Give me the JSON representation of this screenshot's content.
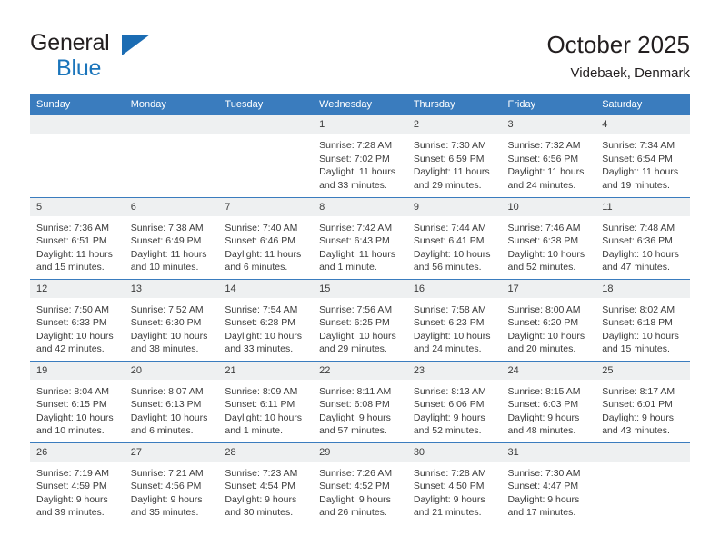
{
  "brand": {
    "name_top": "General",
    "name_bottom": "Blue",
    "accent_color": "#1b75bb",
    "triangle_icon": "brand-triangle-icon"
  },
  "header": {
    "month_title": "October 2025",
    "location": "Videbaek, Denmark"
  },
  "colors": {
    "header_row": "#3a7cbe",
    "daynum_band": "#eef0f1",
    "text": "#3b3b3b"
  },
  "weekday_headers": [
    "Sunday",
    "Monday",
    "Tuesday",
    "Wednesday",
    "Thursday",
    "Friday",
    "Saturday"
  ],
  "weeks": [
    [
      {
        "day": "",
        "empty": true
      },
      {
        "day": "",
        "empty": true
      },
      {
        "day": "",
        "empty": true
      },
      {
        "day": "1",
        "sunrise": "Sunrise: 7:28 AM",
        "sunset": "Sunset: 7:02 PM",
        "daylight_1": "Daylight: 11 hours",
        "daylight_2": "and 33 minutes."
      },
      {
        "day": "2",
        "sunrise": "Sunrise: 7:30 AM",
        "sunset": "Sunset: 6:59 PM",
        "daylight_1": "Daylight: 11 hours",
        "daylight_2": "and 29 minutes."
      },
      {
        "day": "3",
        "sunrise": "Sunrise: 7:32 AM",
        "sunset": "Sunset: 6:56 PM",
        "daylight_1": "Daylight: 11 hours",
        "daylight_2": "and 24 minutes."
      },
      {
        "day": "4",
        "sunrise": "Sunrise: 7:34 AM",
        "sunset": "Sunset: 6:54 PM",
        "daylight_1": "Daylight: 11 hours",
        "daylight_2": "and 19 minutes."
      }
    ],
    [
      {
        "day": "5",
        "sunrise": "Sunrise: 7:36 AM",
        "sunset": "Sunset: 6:51 PM",
        "daylight_1": "Daylight: 11 hours",
        "daylight_2": "and 15 minutes."
      },
      {
        "day": "6",
        "sunrise": "Sunrise: 7:38 AM",
        "sunset": "Sunset: 6:49 PM",
        "daylight_1": "Daylight: 11 hours",
        "daylight_2": "and 10 minutes."
      },
      {
        "day": "7",
        "sunrise": "Sunrise: 7:40 AM",
        "sunset": "Sunset: 6:46 PM",
        "daylight_1": "Daylight: 11 hours",
        "daylight_2": "and 6 minutes."
      },
      {
        "day": "8",
        "sunrise": "Sunrise: 7:42 AM",
        "sunset": "Sunset: 6:43 PM",
        "daylight_1": "Daylight: 11 hours",
        "daylight_2": "and 1 minute."
      },
      {
        "day": "9",
        "sunrise": "Sunrise: 7:44 AM",
        "sunset": "Sunset: 6:41 PM",
        "daylight_1": "Daylight: 10 hours",
        "daylight_2": "and 56 minutes."
      },
      {
        "day": "10",
        "sunrise": "Sunrise: 7:46 AM",
        "sunset": "Sunset: 6:38 PM",
        "daylight_1": "Daylight: 10 hours",
        "daylight_2": "and 52 minutes."
      },
      {
        "day": "11",
        "sunrise": "Sunrise: 7:48 AM",
        "sunset": "Sunset: 6:36 PM",
        "daylight_1": "Daylight: 10 hours",
        "daylight_2": "and 47 minutes."
      }
    ],
    [
      {
        "day": "12",
        "sunrise": "Sunrise: 7:50 AM",
        "sunset": "Sunset: 6:33 PM",
        "daylight_1": "Daylight: 10 hours",
        "daylight_2": "and 42 minutes."
      },
      {
        "day": "13",
        "sunrise": "Sunrise: 7:52 AM",
        "sunset": "Sunset: 6:30 PM",
        "daylight_1": "Daylight: 10 hours",
        "daylight_2": "and 38 minutes."
      },
      {
        "day": "14",
        "sunrise": "Sunrise: 7:54 AM",
        "sunset": "Sunset: 6:28 PM",
        "daylight_1": "Daylight: 10 hours",
        "daylight_2": "and 33 minutes."
      },
      {
        "day": "15",
        "sunrise": "Sunrise: 7:56 AM",
        "sunset": "Sunset: 6:25 PM",
        "daylight_1": "Daylight: 10 hours",
        "daylight_2": "and 29 minutes."
      },
      {
        "day": "16",
        "sunrise": "Sunrise: 7:58 AM",
        "sunset": "Sunset: 6:23 PM",
        "daylight_1": "Daylight: 10 hours",
        "daylight_2": "and 24 minutes."
      },
      {
        "day": "17",
        "sunrise": "Sunrise: 8:00 AM",
        "sunset": "Sunset: 6:20 PM",
        "daylight_1": "Daylight: 10 hours",
        "daylight_2": "and 20 minutes."
      },
      {
        "day": "18",
        "sunrise": "Sunrise: 8:02 AM",
        "sunset": "Sunset: 6:18 PM",
        "daylight_1": "Daylight: 10 hours",
        "daylight_2": "and 15 minutes."
      }
    ],
    [
      {
        "day": "19",
        "sunrise": "Sunrise: 8:04 AM",
        "sunset": "Sunset: 6:15 PM",
        "daylight_1": "Daylight: 10 hours",
        "daylight_2": "and 10 minutes."
      },
      {
        "day": "20",
        "sunrise": "Sunrise: 8:07 AM",
        "sunset": "Sunset: 6:13 PM",
        "daylight_1": "Daylight: 10 hours",
        "daylight_2": "and 6 minutes."
      },
      {
        "day": "21",
        "sunrise": "Sunrise: 8:09 AM",
        "sunset": "Sunset: 6:11 PM",
        "daylight_1": "Daylight: 10 hours",
        "daylight_2": "and 1 minute."
      },
      {
        "day": "22",
        "sunrise": "Sunrise: 8:11 AM",
        "sunset": "Sunset: 6:08 PM",
        "daylight_1": "Daylight: 9 hours",
        "daylight_2": "and 57 minutes."
      },
      {
        "day": "23",
        "sunrise": "Sunrise: 8:13 AM",
        "sunset": "Sunset: 6:06 PM",
        "daylight_1": "Daylight: 9 hours",
        "daylight_2": "and 52 minutes."
      },
      {
        "day": "24",
        "sunrise": "Sunrise: 8:15 AM",
        "sunset": "Sunset: 6:03 PM",
        "daylight_1": "Daylight: 9 hours",
        "daylight_2": "and 48 minutes."
      },
      {
        "day": "25",
        "sunrise": "Sunrise: 8:17 AM",
        "sunset": "Sunset: 6:01 PM",
        "daylight_1": "Daylight: 9 hours",
        "daylight_2": "and 43 minutes."
      }
    ],
    [
      {
        "day": "26",
        "sunrise": "Sunrise: 7:19 AM",
        "sunset": "Sunset: 4:59 PM",
        "daylight_1": "Daylight: 9 hours",
        "daylight_2": "and 39 minutes."
      },
      {
        "day": "27",
        "sunrise": "Sunrise: 7:21 AM",
        "sunset": "Sunset: 4:56 PM",
        "daylight_1": "Daylight: 9 hours",
        "daylight_2": "and 35 minutes."
      },
      {
        "day": "28",
        "sunrise": "Sunrise: 7:23 AM",
        "sunset": "Sunset: 4:54 PM",
        "daylight_1": "Daylight: 9 hours",
        "daylight_2": "and 30 minutes."
      },
      {
        "day": "29",
        "sunrise": "Sunrise: 7:26 AM",
        "sunset": "Sunset: 4:52 PM",
        "daylight_1": "Daylight: 9 hours",
        "daylight_2": "and 26 minutes."
      },
      {
        "day": "30",
        "sunrise": "Sunrise: 7:28 AM",
        "sunset": "Sunset: 4:50 PM",
        "daylight_1": "Daylight: 9 hours",
        "daylight_2": "and 21 minutes."
      },
      {
        "day": "31",
        "sunrise": "Sunrise: 7:30 AM",
        "sunset": "Sunset: 4:47 PM",
        "daylight_1": "Daylight: 9 hours",
        "daylight_2": "and 17 minutes."
      },
      {
        "day": "",
        "empty": true
      }
    ]
  ]
}
